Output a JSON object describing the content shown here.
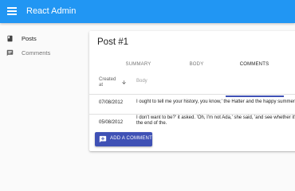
{
  "appbar": {
    "title": "React Admin",
    "menu_icon": "menu-icon",
    "color": "#2196f3"
  },
  "sidebar": {
    "items": [
      {
        "label": "Posts",
        "icon": "book-icon",
        "active": true
      },
      {
        "label": "Comments",
        "icon": "chat-bubble-icon",
        "active": false
      }
    ]
  },
  "main": {
    "title": "Post #1",
    "tabs": [
      {
        "label": "SUMMARY",
        "active": false
      },
      {
        "label": "BODY",
        "active": false
      },
      {
        "label": "COMMENTS",
        "active": true
      }
    ],
    "table": {
      "columns": [
        "Created at",
        "Body"
      ],
      "sort": {
        "column": "Created at",
        "direction": "desc",
        "icon": "arrow-down-icon"
      },
      "rows": [
        {
          "created_at": "07/08/2012",
          "body": "I ought to tell me your history, you know,' the Hatter and the happy summer"
        },
        {
          "created_at": "05/08/2012",
          "body": "I don't want to be?' it asked. 'Oh, I'm not Ada,' she said, 'and see whether it' put her hand on the end of the."
        }
      ]
    },
    "add_button": {
      "label": "ADD A COMMENT",
      "icon": "add-comment-icon"
    },
    "accent_color": "#3f51b5"
  }
}
